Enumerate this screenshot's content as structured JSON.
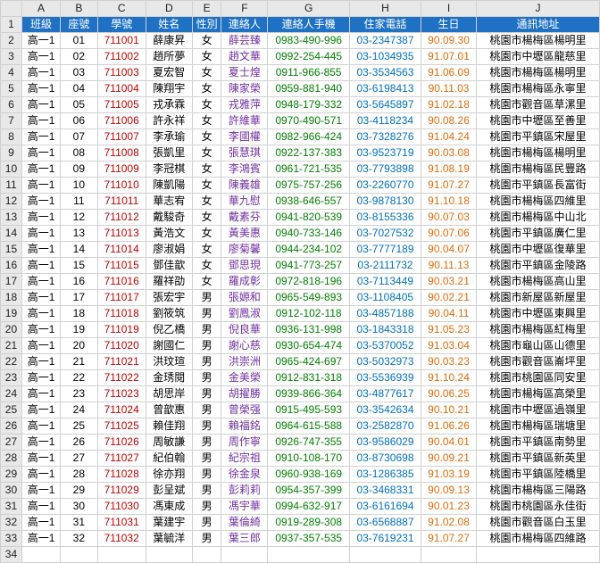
{
  "columns": [
    "A",
    "B",
    "C",
    "D",
    "E",
    "F",
    "G",
    "H",
    "I",
    "J"
  ],
  "headers": [
    "班級",
    "座號",
    "學號",
    "姓名",
    "性別",
    "連絡人",
    "連絡人手機",
    "住家電話",
    "生日",
    "通訊地址"
  ],
  "rows": [
    {
      "r": 2,
      "a": "高一1",
      "b": "01",
      "c": "711001",
      "d": "薛康昇",
      "e": "女",
      "f": "薛芸臻",
      "g": "0983-490-996",
      "h": "03-2347387",
      "i": "90.09.30",
      "j": "桃園市楊梅區楊明里"
    },
    {
      "r": 3,
      "a": "高一1",
      "b": "02",
      "c": "711002",
      "d": "趙所夢",
      "e": "女",
      "f": "趙文華",
      "g": "0992-254-445",
      "h": "03-1034935",
      "i": "91.07.01",
      "j": "桃園市中壢區龍慈里"
    },
    {
      "r": 4,
      "a": "高一1",
      "b": "03",
      "c": "711003",
      "d": "夏宏智",
      "e": "女",
      "f": "夏士煌",
      "g": "0911-966-855",
      "h": "03-3534563",
      "i": "91.06.09",
      "j": "桃園市楊梅區楊明里"
    },
    {
      "r": 5,
      "a": "高一1",
      "b": "04",
      "c": "711004",
      "d": "陳翔宇",
      "e": "女",
      "f": "陳家榮",
      "g": "0959-881-940",
      "h": "03-6198413",
      "i": "90.11.03",
      "j": "桃園市楊梅區永寧里"
    },
    {
      "r": 6,
      "a": "高一1",
      "b": "05",
      "c": "711005",
      "d": "戎承霖",
      "e": "女",
      "f": "戎雅萍",
      "g": "0948-179-332",
      "h": "03-5645897",
      "i": "91.02.18",
      "j": "桃園市觀音區草漯里"
    },
    {
      "r": 7,
      "a": "高一1",
      "b": "06",
      "c": "711006",
      "d": "許永祥",
      "e": "女",
      "f": "許維華",
      "g": "0970-490-571",
      "h": "03-4118234",
      "i": "90.08.26",
      "j": "桃園市中壢區至善里"
    },
    {
      "r": 8,
      "a": "高一1",
      "b": "07",
      "c": "711007",
      "d": "李承瑜",
      "e": "女",
      "f": "李國權",
      "g": "0982-966-424",
      "h": "03-7328276",
      "i": "91.04.24",
      "j": "桃園市平鎮區宋屋里"
    },
    {
      "r": 9,
      "a": "高一1",
      "b": "08",
      "c": "711008",
      "d": "張凱里",
      "e": "女",
      "f": "張慧琪",
      "g": "0922-137-383",
      "h": "03-9523719",
      "i": "90.03.08",
      "j": "桃園市楊梅區楊明里"
    },
    {
      "r": 10,
      "a": "高一1",
      "b": "09",
      "c": "711009",
      "d": "李冠棋",
      "e": "女",
      "f": "李鴻賓",
      "g": "0961-721-535",
      "h": "03-7793898",
      "i": "91.08.19",
      "j": "桃園市楊梅區民豐路"
    },
    {
      "r": 11,
      "a": "高一1",
      "b": "10",
      "c": "711010",
      "d": "陳凱陽",
      "e": "女",
      "f": "陳義雄",
      "g": "0975-757-256",
      "h": "03-2260770",
      "i": "91.07.27",
      "j": "桃園市平鎮區長富街"
    },
    {
      "r": 12,
      "a": "高一1",
      "b": "11",
      "c": "711011",
      "d": "華志宥",
      "e": "女",
      "f": "華九慰",
      "g": "0938-646-557",
      "h": "03-9878130",
      "i": "91.10.18",
      "j": "桃園市楊梅區四維里"
    },
    {
      "r": 13,
      "a": "高一1",
      "b": "12",
      "c": "711012",
      "d": "戴駿奇",
      "e": "女",
      "f": "戴素芬",
      "g": "0941-820-539",
      "h": "03-8155336",
      "i": "90.07.03",
      "j": "桃園市楊梅區中山北"
    },
    {
      "r": 14,
      "a": "高一1",
      "b": "13",
      "c": "711013",
      "d": "黃浩文",
      "e": "女",
      "f": "黃美惠",
      "g": "0940-733-146",
      "h": "03-7027532",
      "i": "90.07.06",
      "j": "桃園市平鎮區廣仁里"
    },
    {
      "r": 15,
      "a": "高一1",
      "b": "14",
      "c": "711014",
      "d": "廖淑娟",
      "e": "女",
      "f": "廖菊馨",
      "g": "0944-234-102",
      "h": "03-7777189",
      "i": "90.04.07",
      "j": "桃園市中壢區復華里"
    },
    {
      "r": 16,
      "a": "高一1",
      "b": "15",
      "c": "711015",
      "d": "鄧佳歆",
      "e": "女",
      "f": "鄧思現",
      "g": "0941-773-257",
      "h": "03-2111732",
      "i": "90.11.13",
      "j": "桃園市平鎮區金陵路"
    },
    {
      "r": 17,
      "a": "高一1",
      "b": "16",
      "c": "711016",
      "d": "羅祥劭",
      "e": "女",
      "f": "羅成彰",
      "g": "0972-818-196",
      "h": "03-7113449",
      "i": "90.03.21",
      "j": "桃園市楊梅區高山里"
    },
    {
      "r": 18,
      "a": "高一1",
      "b": "17",
      "c": "711017",
      "d": "張宏宇",
      "e": "男",
      "f": "張嫄和",
      "g": "0965-549-893",
      "h": "03-1108405",
      "i": "90.02.21",
      "j": "桃園市新屋區新屋里"
    },
    {
      "r": 19,
      "a": "高一1",
      "b": "18",
      "c": "711018",
      "d": "劉筱筑",
      "e": "男",
      "f": "劉鳳淑",
      "g": "0912-102-118",
      "h": "03-4857188",
      "i": "90.04.11",
      "j": "桃園市中壢區東興里"
    },
    {
      "r": 20,
      "a": "高一1",
      "b": "19",
      "c": "711019",
      "d": "倪乙橋",
      "e": "男",
      "f": "倪良華",
      "g": "0936-131-998",
      "h": "03-1843318",
      "i": "91.05.23",
      "j": "桃園市楊梅區紅梅里"
    },
    {
      "r": 21,
      "a": "高一1",
      "b": "20",
      "c": "711020",
      "d": "謝國仁",
      "e": "男",
      "f": "謝心慈",
      "g": "0930-654-474",
      "h": "03-5370052",
      "i": "91.03.04",
      "j": "桃園市龜山區山德里"
    },
    {
      "r": 22,
      "a": "高一1",
      "b": "21",
      "c": "711021",
      "d": "洪玟瑄",
      "e": "男",
      "f": "洪崇洲",
      "g": "0965-424-697",
      "h": "03-5032973",
      "i": "90.03.23",
      "j": "桃園市觀音區崙坪里"
    },
    {
      "r": 23,
      "a": "高一1",
      "b": "22",
      "c": "711022",
      "d": "金琇閱",
      "e": "男",
      "f": "金美榮",
      "g": "0912-831-318",
      "h": "03-5536939",
      "i": "91.10.24",
      "j": "桃園市桃園區同安里"
    },
    {
      "r": 24,
      "a": "高一1",
      "b": "23",
      "c": "711023",
      "d": "胡思岸",
      "e": "男",
      "f": "胡擢勝",
      "g": "0939-866-364",
      "h": "03-4877617",
      "i": "90.06.25",
      "j": "桃園市楊梅區高榮里"
    },
    {
      "r": 25,
      "a": "高一1",
      "b": "24",
      "c": "711024",
      "d": "曾歆惠",
      "e": "男",
      "f": "曾榮强",
      "g": "0915-495-593",
      "h": "03-3542634",
      "i": "90.10.21",
      "j": "桃園市中壢區過嶺里"
    },
    {
      "r": 26,
      "a": "高一1",
      "b": "25",
      "c": "711025",
      "d": "賴佳翔",
      "e": "男",
      "f": "賴福銘",
      "g": "0964-615-588",
      "h": "03-2582870",
      "i": "91.06.26",
      "j": "桃園市楊梅區瑞塘里"
    },
    {
      "r": 27,
      "a": "高一1",
      "b": "26",
      "c": "711026",
      "d": "周敏謙",
      "e": "男",
      "f": "周作寧",
      "g": "0926-747-355",
      "h": "03-9586029",
      "i": "90.04.01",
      "j": "桃園市平鎮區南勢里"
    },
    {
      "r": 28,
      "a": "高一1",
      "b": "27",
      "c": "711027",
      "d": "紀伯翰",
      "e": "男",
      "f": "紀宗祖",
      "g": "0910-108-170",
      "h": "03-8730698",
      "i": "90.09.21",
      "j": "桃園市平鎮區新英里"
    },
    {
      "r": 29,
      "a": "高一1",
      "b": "28",
      "c": "711028",
      "d": "徐亦翔",
      "e": "男",
      "f": "徐金泉",
      "g": "0960-938-169",
      "h": "03-1286385",
      "i": "91.03.19",
      "j": "桃園市平鎮區陸橋里"
    },
    {
      "r": 30,
      "a": "高一1",
      "b": "29",
      "c": "711029",
      "d": "彭呈斌",
      "e": "男",
      "f": "彭莉莉",
      "g": "0954-357-399",
      "h": "03-3468331",
      "i": "90.09.13",
      "j": "桃園市楊梅區三陽路"
    },
    {
      "r": 31,
      "a": "高一1",
      "b": "30",
      "c": "711030",
      "d": "馮東成",
      "e": "男",
      "f": "馮宇華",
      "g": "0994-632-917",
      "h": "03-6161694",
      "i": "90.01.23",
      "j": "桃園市桃園區永佳街"
    },
    {
      "r": 32,
      "a": "高一1",
      "b": "31",
      "c": "711031",
      "d": "葉建宇",
      "e": "男",
      "f": "葉倫綺",
      "g": "0919-289-308",
      "h": "03-6568887",
      "i": "91.02.08",
      "j": "桃園市觀音區白玉里"
    },
    {
      "r": 33,
      "a": "高一1",
      "b": "32",
      "c": "711032",
      "d": "葉毓洋",
      "e": "男",
      "f": "葉三郎",
      "g": "0937-357-535",
      "h": "03-7619231",
      "i": "91.07.27",
      "j": "桃園市楊梅區四維路"
    }
  ]
}
